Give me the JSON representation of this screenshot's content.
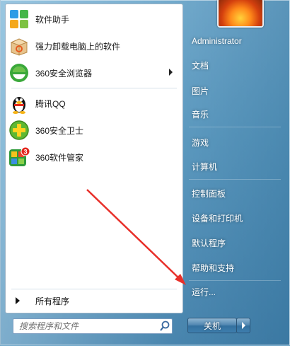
{
  "programs": [
    {
      "label": "软件助手",
      "icon": "software-helper-icon"
    },
    {
      "label": "强力卸载电脑上的软件",
      "icon": "uninstaller-box-icon"
    },
    {
      "label": "360安全浏览器",
      "icon": "360-browser-icon",
      "has_submenu": true
    },
    {
      "label": "腾讯QQ",
      "icon": "qq-penguin-icon"
    },
    {
      "label": "360安全卫士",
      "icon": "360-safeguard-icon"
    },
    {
      "label": "360软件管家",
      "icon": "360-software-manager-icon",
      "badge": "3"
    }
  ],
  "all_programs": "所有程序",
  "search": {
    "placeholder": "搜索程序和文件"
  },
  "right_items": [
    {
      "label": "Administrator"
    },
    {
      "label": "文档"
    },
    {
      "label": "图片"
    },
    {
      "label": "音乐"
    },
    {
      "label": "游戏"
    },
    {
      "label": "计算机"
    },
    {
      "label": "控制面板"
    },
    {
      "label": "设备和打印机"
    },
    {
      "label": "默认程序"
    },
    {
      "label": "帮助和支持"
    },
    {
      "label": "运行..."
    }
  ],
  "shutdown": {
    "label": "关机"
  },
  "colors": {
    "accent": "#2f6e9a",
    "annotation_arrow": "#e8302a"
  }
}
